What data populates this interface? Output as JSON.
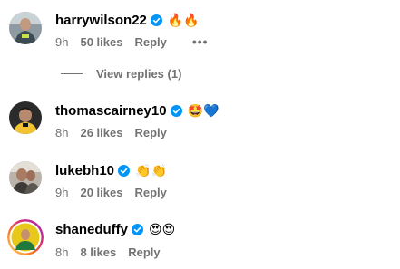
{
  "comments": [
    {
      "username": "harrywilson22",
      "reaction": "🔥🔥",
      "time": "9h",
      "likes": "50 likes",
      "reply": "Reply",
      "more": "•••",
      "view_replies": "View replies (1)"
    },
    {
      "username": "thomascairney10",
      "reaction": "🤩💙",
      "time": "8h",
      "likes": "26 likes",
      "reply": "Reply"
    },
    {
      "username": "lukebh10",
      "reaction": "👏👏",
      "time": "9h",
      "likes": "20 likes",
      "reply": "Reply"
    },
    {
      "username": "shaneduffy",
      "reaction": "😍😍",
      "time": "8h",
      "likes": "8 likes",
      "reply": "Reply"
    }
  ],
  "colors": {
    "verified": "#0095f6",
    "secondary_text": "#737373",
    "story_ring": "#d62976"
  },
  "icons": {
    "verified": "verified-badge-icon",
    "more": "more-options-icon"
  }
}
